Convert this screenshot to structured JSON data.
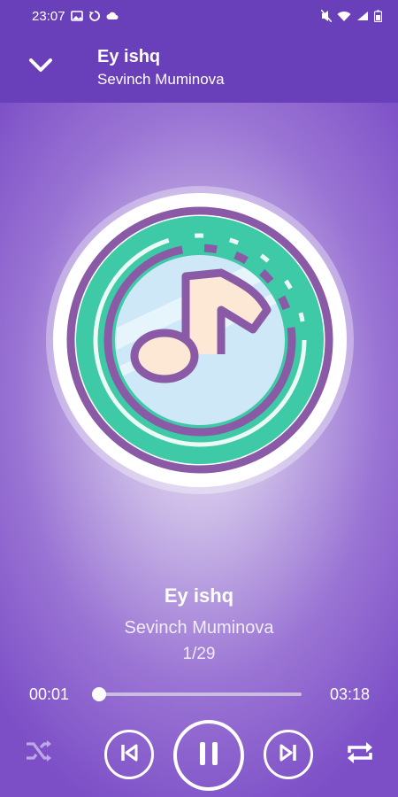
{
  "status_bar": {
    "time": "23:07",
    "left_icons": [
      "gallery-icon",
      "sync-icon",
      "cloud-icon"
    ],
    "right_icons": [
      "mute-icon",
      "wifi-icon",
      "signal-icon",
      "battery-icon"
    ]
  },
  "header": {
    "title": "Ey ishq",
    "artist": "Sevinch Muminova",
    "back_icon": "chevron-down-icon"
  },
  "album_art": {
    "icon": "music-note-icon"
  },
  "now_playing": {
    "title": "Ey ishq",
    "artist": "Sevinch Muminova",
    "index": "1/29"
  },
  "progress": {
    "current": "00:01",
    "total": "03:18",
    "fraction": 0.005
  },
  "controls": {
    "shuffle_icon": "shuffle-icon",
    "previous_icon": "skip-previous-icon",
    "play_pause_icon": "pause-icon",
    "next_icon": "skip-next-icon",
    "repeat_icon": "repeat-icon"
  },
  "colors": {
    "primary": "#6a3fba",
    "teal": "#3ec9a7",
    "ring": "#8a5aa6",
    "note": "#fde8d5"
  }
}
